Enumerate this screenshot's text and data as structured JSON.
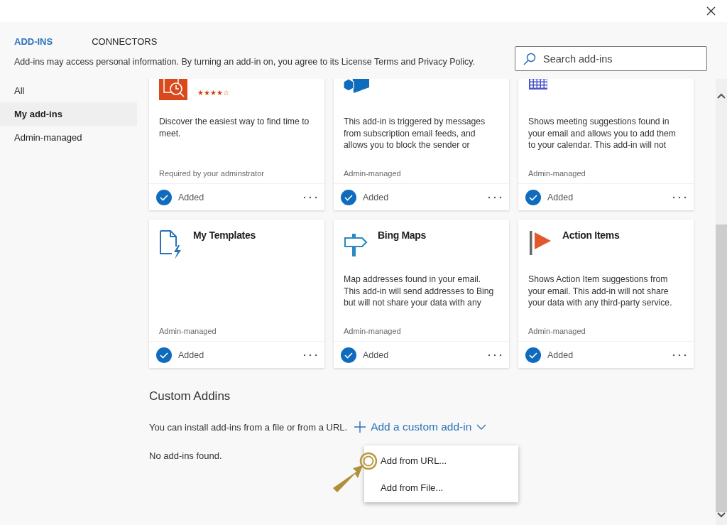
{
  "tabs": [
    {
      "label": "ADD-INS",
      "selected": true
    },
    {
      "label": "CONNECTORS",
      "selected": false
    }
  ],
  "notice": "Add-ins may access personal information. By turning an add-in on, you agree to its License Terms and Privacy Policy.",
  "search": {
    "placeholder": "Search add-ins"
  },
  "sidebar": {
    "items": [
      {
        "label": "All",
        "selected": false
      },
      {
        "label": "My add-ins",
        "selected": true
      },
      {
        "label": "Admin-managed",
        "selected": false
      }
    ]
  },
  "cards": [
    {
      "kind": "findtime",
      "stars": 4,
      "description": "Discover the easiest way to find time to meet.",
      "managed": "Required by your adminstrator",
      "added": true,
      "status": "Added"
    },
    {
      "kind": "cube",
      "description": "This add-in is triggered by messages from subscription email feeds, and allows you to block the sender or",
      "managed": "Admin-managed",
      "added": true,
      "status": "Added"
    },
    {
      "kind": "calendar",
      "description": "Shows meeting suggestions found in your email and allows you to add them to your calendar. This add-in will not",
      "managed": "Admin-managed",
      "added": true,
      "status": "Added"
    },
    {
      "kind": "template",
      "title": "My Templates",
      "managed": "Admin-managed",
      "added": true,
      "status": "Added"
    },
    {
      "kind": "signpost",
      "title": "Bing Maps",
      "description": "Map addresses found in your email. This add-in will send addresses to Bing but will not share your data with any",
      "managed": "Admin-managed",
      "added": true,
      "status": "Added"
    },
    {
      "kind": "flag",
      "title": "Action Items",
      "description": "Shows Action Item suggestions from your email. This add-in will not share your data with any third-party service.",
      "managed": "Admin-managed",
      "added": true,
      "status": "Added"
    }
  ],
  "custom": {
    "heading": "Custom Addins",
    "hint": "You can install add-ins from a file or from a URL.",
    "add_button": "Add a custom add-in",
    "empty": "No add-ins found.",
    "menu": [
      {
        "label": "Add from URL..."
      },
      {
        "label": "Add from File..."
      }
    ]
  }
}
